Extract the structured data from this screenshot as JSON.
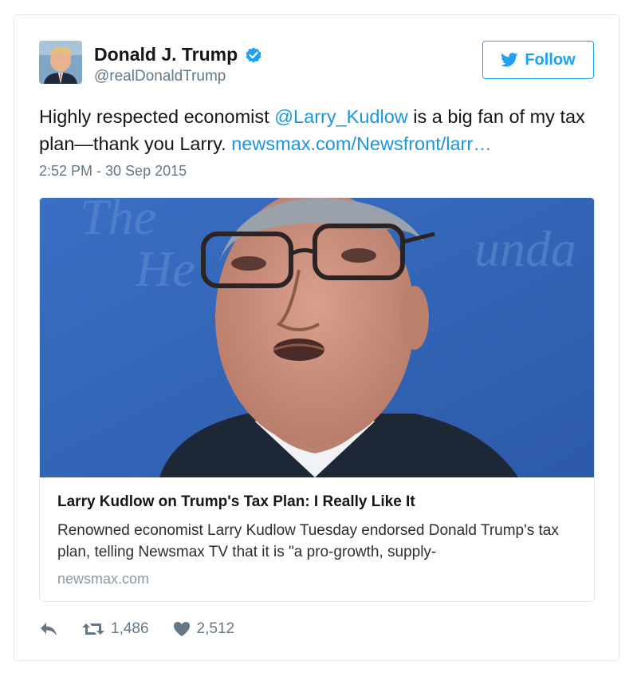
{
  "author": {
    "name": "Donald J. Trump",
    "handle": "@realDonaldTrump",
    "verified_icon": "verified-badge-icon"
  },
  "follow": {
    "label": "Follow",
    "icon": "twitter-bird-icon"
  },
  "tweet": {
    "text_before_mention": "Highly respected economist ",
    "mention": "@Larry_Kudlow",
    "text_after_mention": " is a big fan of my tax plan—thank you Larry. ",
    "link": "newsmax.com/Newsfront/larr…",
    "timestamp": "2:52 PM - 30 Sep 2015"
  },
  "card": {
    "title": "Larry Kudlow on Trump's Tax Plan: I Really Like It",
    "description": "Renowned economist Larry Kudlow Tuesday endorsed Donald Trump's tax plan, telling Newsmax TV that it is \"a pro-growth, supply-",
    "domain": "newsmax.com",
    "image_background_text": [
      "The",
      "He",
      "unda"
    ]
  },
  "actions": {
    "reply_icon": "reply-icon",
    "retweet_icon": "retweet-icon",
    "retweet_count": "1,486",
    "like_icon": "heart-icon",
    "like_count": "2,512"
  },
  "colors": {
    "link_blue": "#1b95e0",
    "follow_blue": "#1da1f2",
    "muted_gray": "#657786",
    "border": "#e1e8ed"
  }
}
